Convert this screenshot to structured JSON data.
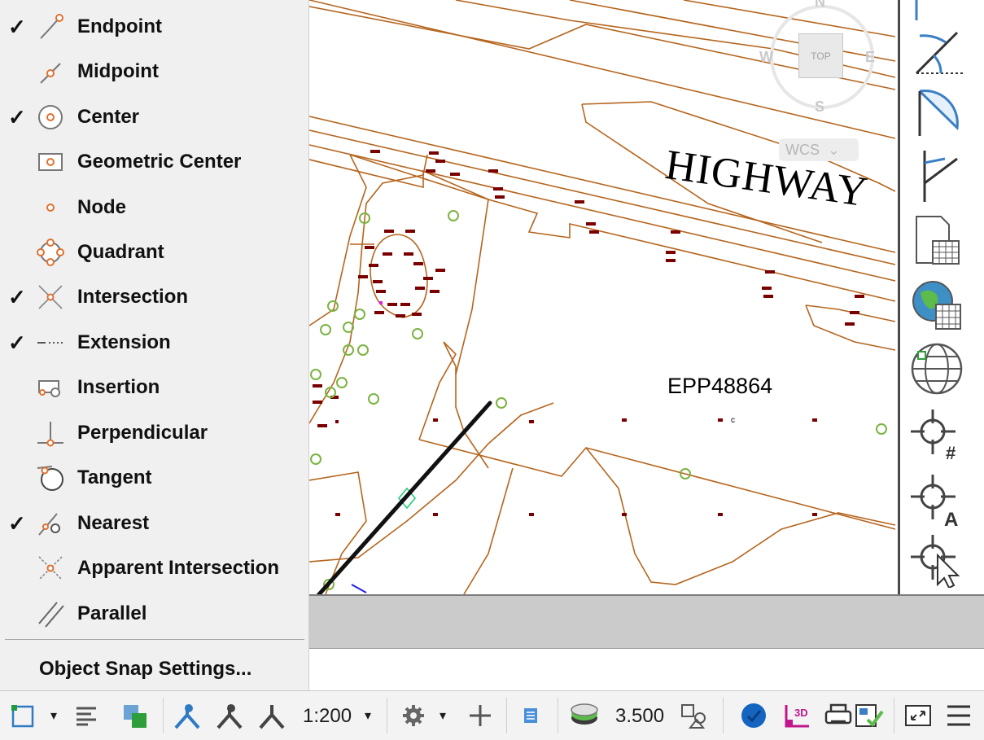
{
  "snap_menu": {
    "items": [
      {
        "label": "Endpoint",
        "checked": true,
        "icon": "endpoint-snap-icon"
      },
      {
        "label": "Midpoint",
        "checked": false,
        "icon": "midpoint-snap-icon"
      },
      {
        "label": "Center",
        "checked": true,
        "icon": "center-snap-icon"
      },
      {
        "label": "Geometric Center",
        "checked": false,
        "icon": "geometric-center-snap-icon"
      },
      {
        "label": "Node",
        "checked": false,
        "icon": "node-snap-icon"
      },
      {
        "label": "Quadrant",
        "checked": false,
        "icon": "quadrant-snap-icon"
      },
      {
        "label": "Intersection",
        "checked": true,
        "icon": "intersection-snap-icon"
      },
      {
        "label": "Extension",
        "checked": true,
        "icon": "extension-snap-icon"
      },
      {
        "label": "Insertion",
        "checked": false,
        "icon": "insertion-snap-icon"
      },
      {
        "label": "Perpendicular",
        "checked": false,
        "icon": "perpendicular-snap-icon"
      },
      {
        "label": "Tangent",
        "checked": false,
        "icon": "tangent-snap-icon"
      },
      {
        "label": "Nearest",
        "checked": true,
        "icon": "nearest-snap-icon"
      },
      {
        "label": "Apparent Intersection",
        "checked": false,
        "icon": "apparent-intersection-snap-icon"
      },
      {
        "label": "Parallel",
        "checked": false,
        "icon": "parallel-snap-icon"
      }
    ],
    "check_mark": "✓",
    "settings_label": "Object Snap Settings..."
  },
  "viewcube": {
    "north": "N",
    "west": "W",
    "east": "E",
    "south": "S",
    "top": "TOP",
    "wcs": "WCS",
    "wcs_chevron": "⌄"
  },
  "drawing": {
    "highway_text": "HIGHWAY",
    "parcel_label": "EPP48864",
    "small_label": "c",
    "colors": {
      "contour": "#b5651d",
      "building": "#7a0000",
      "tree": "#7cb342",
      "arrow": "#000000"
    }
  },
  "statusbar": {
    "scale": "1:200",
    "scale_caret": "▾",
    "lineweight_value": "3.500",
    "dropdown_caret": "▾"
  },
  "palette": {
    "tools": [
      "angular-dimension-icon",
      "arc-dimension-icon",
      "radius-dimension-icon",
      "table-icon",
      "geo-map-icon",
      "globe-locate-icon",
      "snap-grid-icon",
      "snap-annotate-icon",
      "snap-cursor-icon"
    ]
  }
}
